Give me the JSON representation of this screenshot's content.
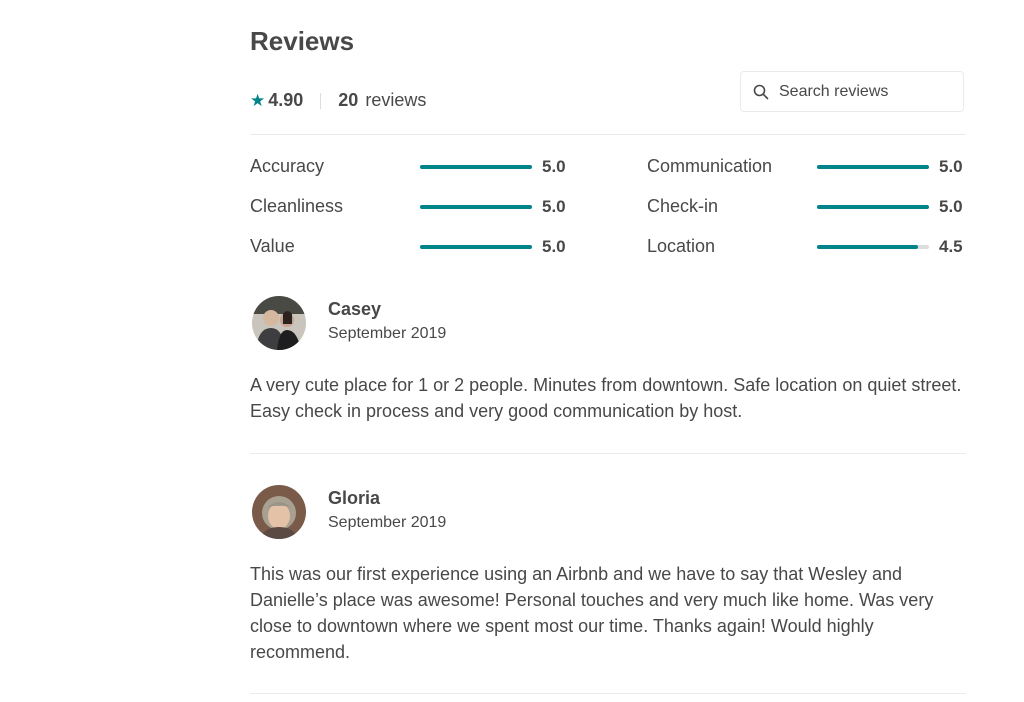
{
  "header": {
    "title": "Reviews",
    "rating": "4.90",
    "review_count": "20",
    "review_count_label": "reviews"
  },
  "search": {
    "placeholder": "Search reviews",
    "value": ""
  },
  "colors": {
    "accent": "#008489",
    "text": "#484848",
    "track": "#dddddd",
    "divider": "#ebebeb"
  },
  "categories": [
    {
      "label": "Accuracy",
      "score": "5.0",
      "value": 5.0,
      "max": 5
    },
    {
      "label": "Communication",
      "score": "5.0",
      "value": 5.0,
      "max": 5
    },
    {
      "label": "Cleanliness",
      "score": "5.0",
      "value": 5.0,
      "max": 5
    },
    {
      "label": "Check-in",
      "score": "5.0",
      "value": 5.0,
      "max": 5
    },
    {
      "label": "Value",
      "score": "5.0",
      "value": 5.0,
      "max": 5
    },
    {
      "label": "Location",
      "score": "4.5",
      "value": 4.5,
      "max": 5
    }
  ],
  "reviews": [
    {
      "name": "Casey",
      "date": "September 2019",
      "avatar_icon": "user-photo-couple",
      "text": "A very cute place for 1 or 2 people. Minutes from downtown. Safe location on quiet street. Easy check in process and very good communication by host."
    },
    {
      "name": "Gloria",
      "date": "September 2019",
      "avatar_icon": "user-photo-woman",
      "text": "This was our first experience using an Airbnb and we have to say that Wesley and Danielle’s place was awesome! Personal touches and very much like home. Was very close to downtown where we spent most our time. Thanks again! Would highly recommend."
    }
  ]
}
